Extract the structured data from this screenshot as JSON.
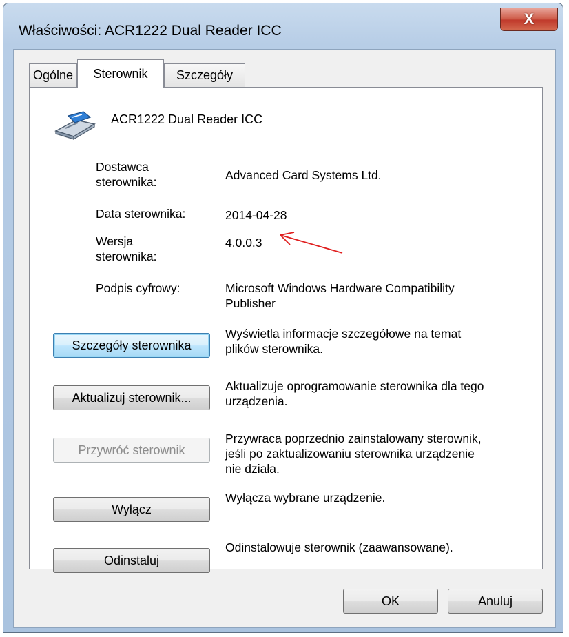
{
  "window": {
    "title": "Właściwości: ACR1222 Dual Reader ICC",
    "close_glyph": "X"
  },
  "tabs": [
    {
      "label": "Ogólne"
    },
    {
      "label": "Sterownik"
    },
    {
      "label": "Szczegóły"
    }
  ],
  "device": {
    "name": "ACR1222 Dual Reader ICC",
    "icon": "card-reader-icon"
  },
  "properties": {
    "provider_label_line1": "Dostawca",
    "provider_label_line2": "sterownika:",
    "provider_value": "Advanced Card Systems Ltd.",
    "date_label": "Data sterownika:",
    "date_value": "2014-04-28",
    "version_label_line1": "Wersja",
    "version_label_line2": "sterownika:",
    "version_value": "4.0.0.3",
    "signer_label": "Podpis cyfrowy:",
    "signer_value_line1": "Microsoft Windows Hardware Compatibility",
    "signer_value_line2": "Publisher"
  },
  "actions": [
    {
      "label": "Szczegóły sterownika",
      "desc_line1": "Wyświetla informacje szczegółowe na temat",
      "desc_line2": "plików sterownika."
    },
    {
      "label": "Aktualizuj sterownik...",
      "desc_line1": "Aktualizuje oprogramowanie sterownika dla tego",
      "desc_line2": "urządzenia."
    },
    {
      "label": "Przywróć sterownik",
      "desc_line1": "Przywraca poprzednio zainstalowany sterownik,",
      "desc_line2": "jeśli po zaktualizowaniu sterownika urządzenie",
      "desc_line3": "nie działa."
    },
    {
      "label": "Wyłącz",
      "desc_line1": "Wyłącza wybrane urządzenie."
    },
    {
      "label": "Odinstaluj",
      "desc_line1": "Odinstalowuje sterownik (zaawansowane)."
    }
  ],
  "footer": {
    "ok": "OK",
    "cancel": "Anuluj"
  },
  "colors": {
    "annotation_arrow": "#e02020",
    "focus_blue": "#3c7fb1"
  }
}
